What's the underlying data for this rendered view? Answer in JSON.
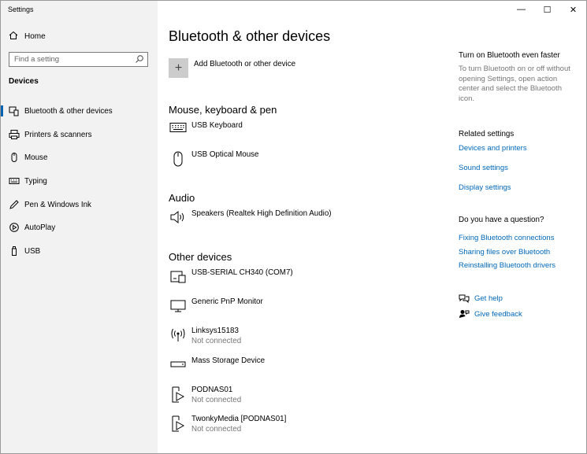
{
  "window": {
    "title": "Settings",
    "minimize": "—",
    "maximize": "☐",
    "close": "✕"
  },
  "sidebar": {
    "home_label": "Home",
    "search_placeholder": "Find a setting",
    "section": "Devices",
    "items": [
      {
        "label": "Bluetooth & other devices",
        "icon": "bluetooth-devices-icon",
        "active": true
      },
      {
        "label": "Printers & scanners",
        "icon": "printer-icon"
      },
      {
        "label": "Mouse",
        "icon": "mouse-icon"
      },
      {
        "label": "Typing",
        "icon": "keyboard-icon"
      },
      {
        "label": "Pen & Windows Ink",
        "icon": "pen-icon"
      },
      {
        "label": "AutoPlay",
        "icon": "autoplay-icon"
      },
      {
        "label": "USB",
        "icon": "usb-icon"
      }
    ]
  },
  "main": {
    "title": "Bluetooth & other devices",
    "add_label": "Add Bluetooth or other device",
    "groups": {
      "mouse_keyboard": {
        "heading": "Mouse, keyboard & pen",
        "devices": [
          {
            "name": "USB Keyboard",
            "icon": "keyboard-icon"
          },
          {
            "name": "USB Optical Mouse",
            "icon": "mouse-icon"
          }
        ]
      },
      "audio": {
        "heading": "Audio",
        "devices": [
          {
            "name": "Speakers (Realtek High Definition Audio)",
            "icon": "speaker-icon"
          }
        ]
      },
      "other": {
        "heading": "Other devices",
        "devices": [
          {
            "name": "USB-SERIAL CH340 (COM7)",
            "icon": "device-icon"
          },
          {
            "name": "Generic PnP Monitor",
            "icon": "monitor-icon"
          },
          {
            "name": "Linksys15183",
            "status": "Not connected",
            "icon": "wireless-icon"
          },
          {
            "name": "Mass Storage Device",
            "icon": "drive-icon"
          },
          {
            "name": "PODNAS01",
            "status": "Not connected",
            "icon": "media-device-icon"
          },
          {
            "name": "TwonkyMedia [PODNAS01]",
            "status": "Not connected",
            "icon": "media-device-icon"
          }
        ]
      }
    }
  },
  "right": {
    "tip_heading": "Turn on Bluetooth even faster",
    "tip_text": "To turn Bluetooth on or off without opening Settings, open action center and select the Bluetooth icon.",
    "related_heading": "Related settings",
    "related_links": [
      "Devices and printers",
      "Sound settings",
      "Display settings"
    ],
    "question_heading": "Do you have a question?",
    "question_links": [
      "Fixing Bluetooth connections",
      "Sharing files over Bluetooth",
      "Reinstalling Bluetooth drivers"
    ],
    "help_label": "Get help",
    "feedback_label": "Give feedback"
  },
  "colors": {
    "accent": "#0067b8",
    "sidebar_bg": "#f2f2f2",
    "muted": "#767676"
  }
}
